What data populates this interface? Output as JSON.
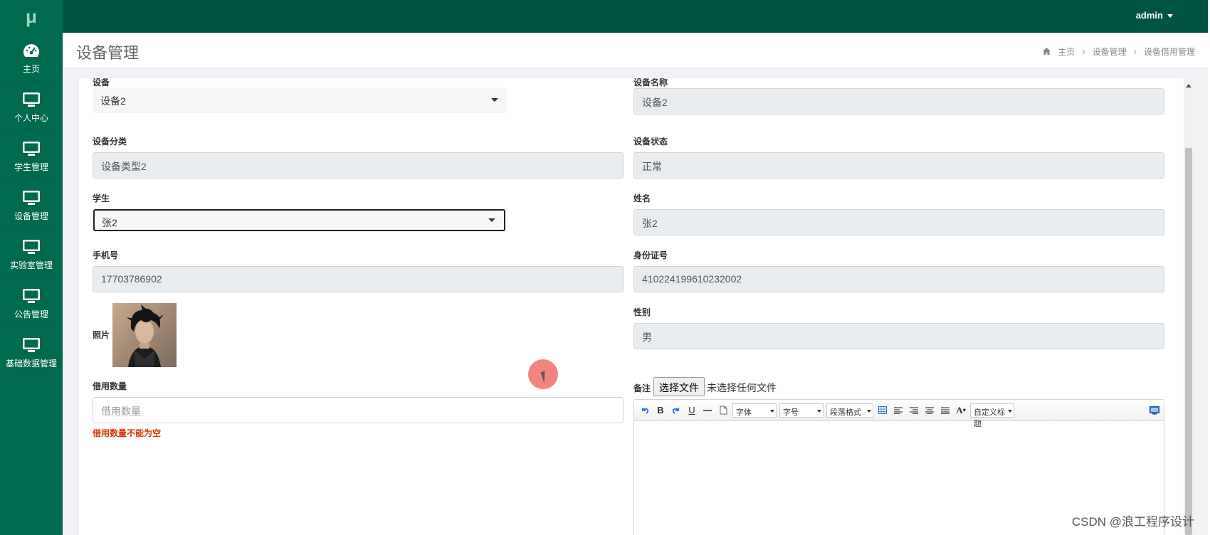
{
  "app": {
    "logo": "μ"
  },
  "sidebar": {
    "items": [
      {
        "label": "主页",
        "icon": "dashboard-icon"
      },
      {
        "label": "个人中心",
        "icon": "monitor-icon"
      },
      {
        "label": "学生管理",
        "icon": "monitor-icon"
      },
      {
        "label": "设备管理",
        "icon": "monitor-icon"
      },
      {
        "label": "实验室管理",
        "icon": "monitor-icon"
      },
      {
        "label": "公告管理",
        "icon": "monitor-icon"
      },
      {
        "label": "基础数据管理",
        "icon": "monitor-icon"
      }
    ]
  },
  "topbar": {
    "user": "admin"
  },
  "header": {
    "title": "设备管理",
    "breadcrumb": [
      "主页",
      "设备管理",
      "设备借用管理"
    ]
  },
  "form": {
    "device": {
      "label": "设备",
      "value": "设备2"
    },
    "device_name": {
      "label": "设备名称",
      "value": "设备2"
    },
    "device_category": {
      "label": "设备分类",
      "value": "设备类型2"
    },
    "device_status": {
      "label": "设备状态",
      "value": "正常"
    },
    "student": {
      "label": "学生",
      "value": "张2"
    },
    "name": {
      "label": "姓名",
      "value": "张2"
    },
    "phone": {
      "label": "手机号",
      "value": "17703786902"
    },
    "id_number": {
      "label": "身份证号",
      "value": "410224199610232002"
    },
    "photo": {
      "label": "照片"
    },
    "gender": {
      "label": "性别",
      "value": "男"
    },
    "borrow_count": {
      "label": "借用数量",
      "placeholder": "借用数量",
      "error": "借用数量不能为空"
    },
    "remark": {
      "label": "备注",
      "file_button": "选择文件",
      "file_status": "未选择任何文件"
    }
  },
  "editor": {
    "bold": "B",
    "underline": "U",
    "font": "字体",
    "font_size": "字号",
    "paragraph": "段落格式",
    "font_color": "A",
    "custom_title": "自定义标题"
  },
  "watermark": "CSDN @浪工程序设计",
  "colors": {
    "sidebar": "#006a4e",
    "topbar": "#005541",
    "error": "#d4380d"
  }
}
